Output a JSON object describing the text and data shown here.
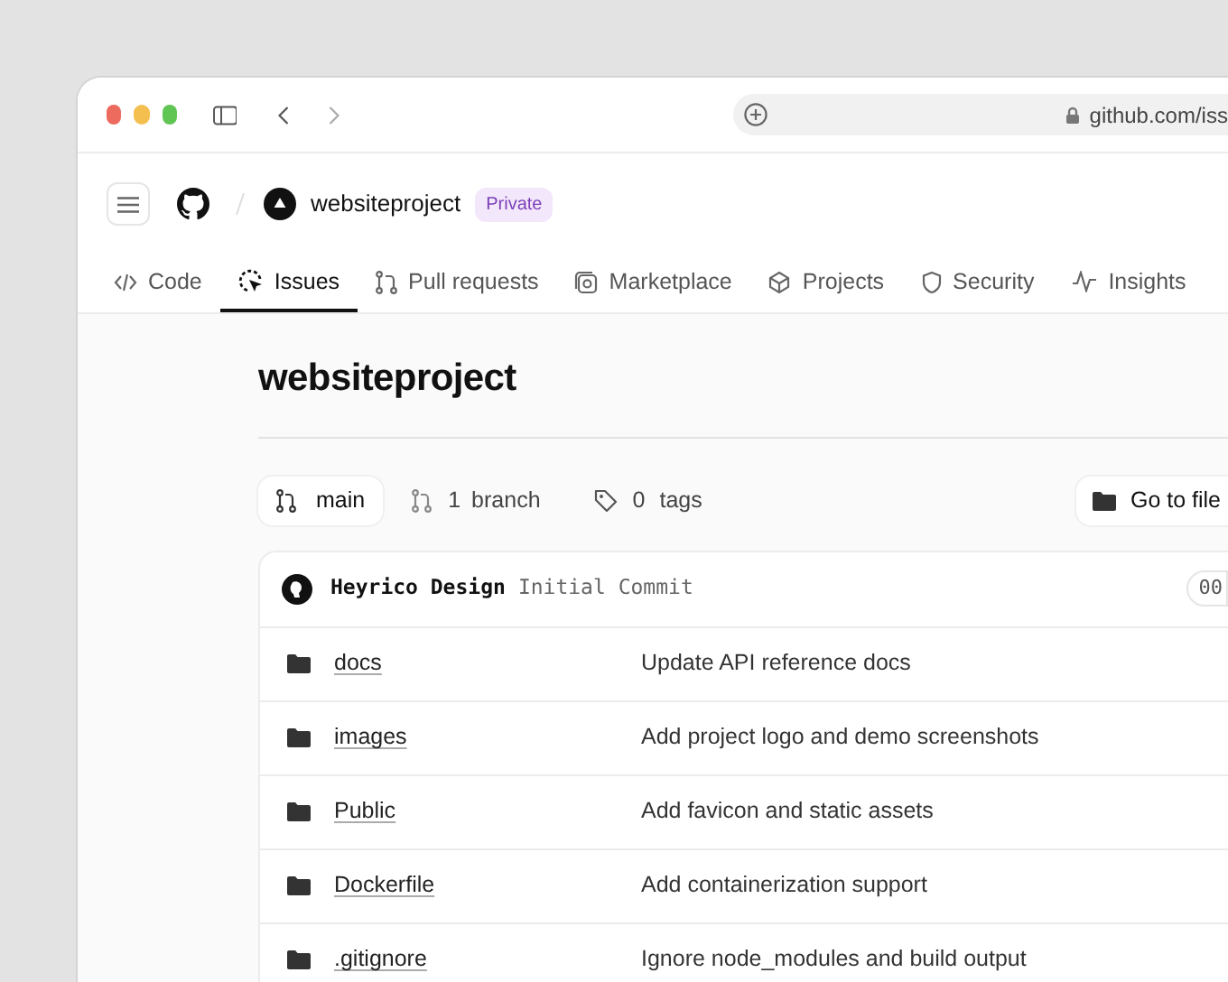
{
  "browser": {
    "url": "github.com/iss"
  },
  "repo": {
    "name": "websiteproject",
    "visibility": "Private"
  },
  "tabs": [
    {
      "label": "Code",
      "selected": false
    },
    {
      "label": "Issues",
      "selected": true
    },
    {
      "label": "Pull requests",
      "selected": false
    },
    {
      "label": "Marketplace",
      "selected": false
    },
    {
      "label": "Projects",
      "selected": false
    },
    {
      "label": "Security",
      "selected": false
    },
    {
      "label": "Insights",
      "selected": false
    }
  ],
  "title": "websiteproject",
  "branch_bar": {
    "branch": "main",
    "branch_count": "1",
    "branch_label": "branch",
    "tag_count": "0",
    "tag_label": "tags",
    "go_to_file": "Go to file"
  },
  "commit": {
    "author": "Heyrico Design",
    "message": "Initial Commit",
    "hash": "00"
  },
  "files": [
    {
      "name": "docs",
      "message": "Update API reference docs"
    },
    {
      "name": "images",
      "message": "Add project logo and demo screenshots"
    },
    {
      "name": "Public",
      "message": "Add favicon and static assets"
    },
    {
      "name": "Dockerfile",
      "message": "Add containerization support"
    },
    {
      "name": ".gitignore",
      "message": "Ignore node_modules and build output"
    }
  ]
}
